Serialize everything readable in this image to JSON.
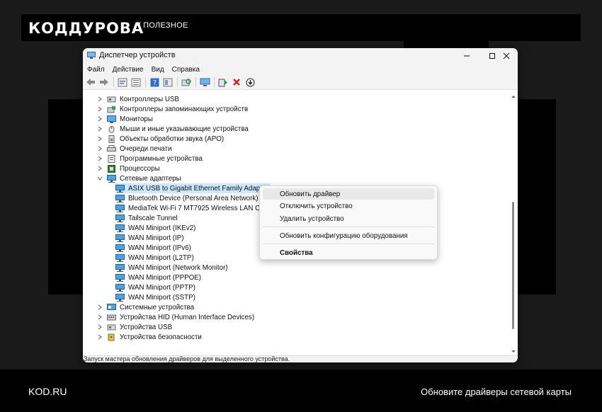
{
  "brand": {
    "logo": "КОДДУРОВА",
    "tag": "// ПОЛЕЗНОЕ",
    "site": "KOD.RU",
    "caption": "Обновите драйверы сетевой карты"
  },
  "window": {
    "title": "Диспетчер устройств",
    "menu": [
      "Файл",
      "Действие",
      "Вид",
      "Справка"
    ],
    "toolbar_icons": [
      "back-icon",
      "forward-icon",
      "properties-icon",
      "list-icon",
      "help-icon",
      "view-icon",
      "scan-icon",
      "monitor-icon",
      "add-driver-icon",
      "remove-icon",
      "update-icon"
    ],
    "status": "Запуск мастера обновления драйверов для выделенного устройства."
  },
  "tree": {
    "top_categories": [
      {
        "label": "Контроллеры USB",
        "icon": "usb-icon"
      },
      {
        "label": "Контроллеры запоминающих устройств",
        "icon": "storage-controller-icon"
      },
      {
        "label": "Мониторы",
        "icon": "monitor-icon"
      },
      {
        "label": "Мыши и иные указывающие устройства",
        "icon": "mouse-icon"
      },
      {
        "label": "Объекты обработки звука (APO)",
        "icon": "speaker-icon"
      },
      {
        "label": "Очереди печати",
        "icon": "printer-icon"
      },
      {
        "label": "Программные устройства",
        "icon": "software-device-icon"
      },
      {
        "label": "Процессоры",
        "icon": "cpu-icon"
      }
    ],
    "expanded": {
      "label": "Сетевые адаптеры",
      "icon": "network-adapter-icon"
    },
    "adapters": [
      "ASIX USB to Gigabit Ethernet Family Adapter",
      "Bluetooth Device (Personal Area Network)",
      "MediaTek Wi-Fi 7 MT7925 Wireless LAN Card",
      "Tailscale Tunnel",
      "WAN Miniport (IKEv2)",
      "WAN Miniport (IP)",
      "WAN Miniport (IPv6)",
      "WAN Miniport (L2TP)",
      "WAN Miniport (Network Monitor)",
      "WAN Miniport (PPPOE)",
      "WAN Miniport (PPTP)",
      "WAN Miniport (SSTP)"
    ],
    "bottom_categories": [
      {
        "label": "Системные устройства",
        "icon": "system-device-icon"
      },
      {
        "label": "Устройства HID (Human Interface Devices)",
        "icon": "hid-icon"
      },
      {
        "label": "Устройства USB",
        "icon": "usb-device-icon"
      },
      {
        "label": "Устройства безопасности",
        "icon": "security-device-icon"
      }
    ]
  },
  "context_menu": {
    "items": [
      "Обновить драйвер",
      "Отключить устройство",
      "Удалить устройство",
      "Обновить конфигурацию оборудования",
      "Свойства"
    ]
  }
}
